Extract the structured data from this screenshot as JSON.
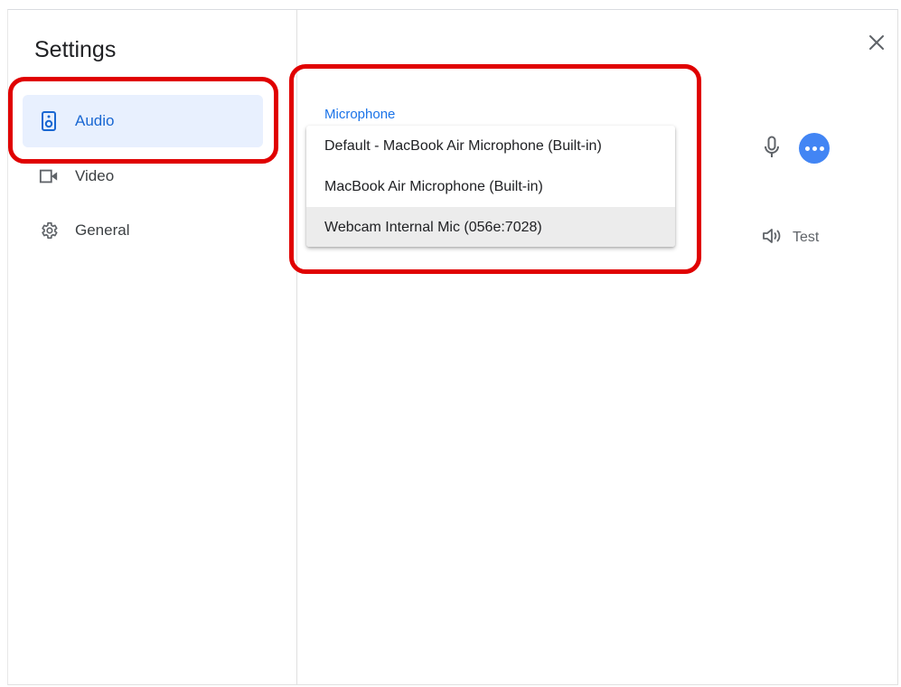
{
  "sidebar": {
    "title": "Settings",
    "items": [
      {
        "label": "Audio",
        "icon": "speaker-icon",
        "active": true
      },
      {
        "label": "Video",
        "icon": "video-camera-icon",
        "active": false
      },
      {
        "label": "General",
        "icon": "gear-icon",
        "active": false
      }
    ]
  },
  "microphone": {
    "label": "Microphone",
    "options": [
      {
        "label": "Default - MacBook Air Microphone (Built-in)"
      },
      {
        "label": "MacBook Air Microphone (Built-in)"
      },
      {
        "label": "Webcam Internal Mic (056e:7028)",
        "highlighted": true
      }
    ]
  },
  "speaker": {
    "test_label": "Test"
  },
  "colors": {
    "accent": "#1a73e8",
    "active_bg": "#e8f0fe",
    "more_button": "#4285f4",
    "annotation_red": "#e00000"
  },
  "icons": {
    "close": "close-icon",
    "mic": "microphone-icon",
    "more": "more-horizontal-icon",
    "speaker": "speaker-volume-icon"
  }
}
